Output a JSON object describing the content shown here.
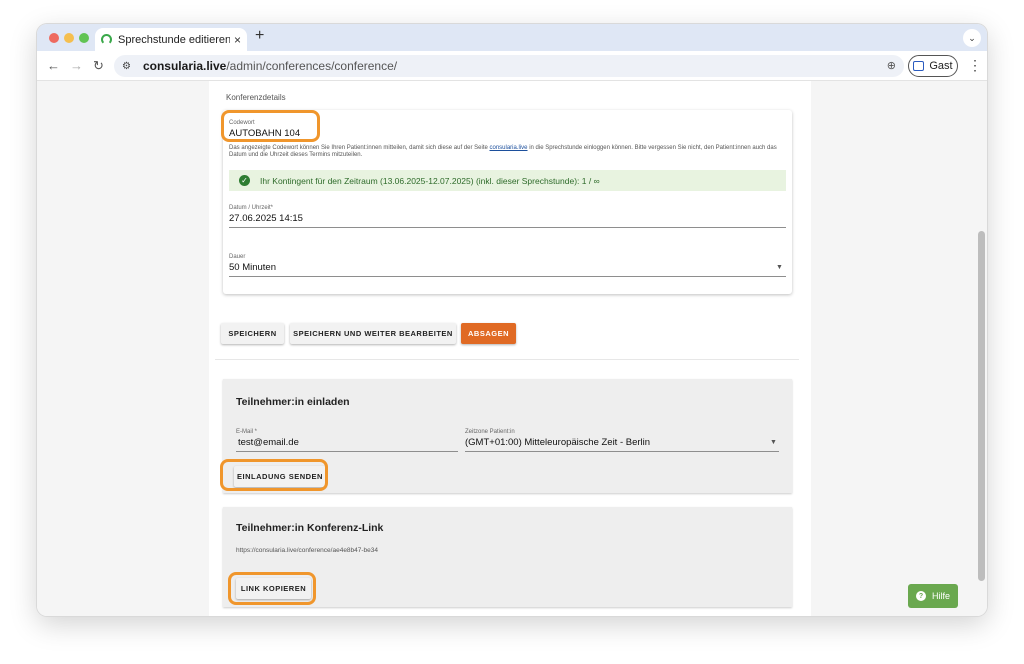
{
  "browser": {
    "tab_title": "Sprechstunde editieren",
    "tab_close": "×",
    "new_tab": "+",
    "tab_menu": "⌄",
    "url_host": "consularia.live",
    "url_path": "/admin/conferences/conference/",
    "profile_label": "Gast",
    "colors": {
      "close_dot": "#ee6a5f",
      "min_dot": "#f5bf4f",
      "max_dot": "#61c454"
    }
  },
  "form": {
    "section_title": "Konferenzdetails",
    "code_label": "Codewort",
    "code_value": "AUTOBAHN 104",
    "hint_before": "Das angezeigte Codewort können Sie Ihren Patient:innen mitteilen, damit sich diese auf der Seite ",
    "hint_link": "consularia.live",
    "hint_after": " in die Sprechstunde einloggen können. Bitte vergessen Sie nicht, den Patient:innen auch das Datum und die Uhrzeit dieses Termins mitzuteilen.",
    "quota_text": "Ihr Kontingent für den Zeitraum (13.06.2025-12.07.2025) (inkl. dieser Sprechstunde): 1 / ∞",
    "date_label": "Datum / Uhrzeit*",
    "date_value": "27.06.2025 14:15",
    "duration_label": "Dauer",
    "duration_value": "50 Minuten"
  },
  "actions": {
    "save": "SPEICHERN",
    "save_continue": "SPEICHERN UND WEITER BEARBEITEN",
    "cancel": "ABSAGEN"
  },
  "invite": {
    "heading": "Teilnehmer:in einladen",
    "email_label": "E-Mail *",
    "email_value": "test@email.de",
    "timezone_label": "Zeitzone Patient:in",
    "timezone_value": "(GMT+01:00) Mitteleuropäische Zeit - Berlin",
    "send_button": "EINLADUNG SENDEN"
  },
  "link": {
    "heading": "Teilnehmer:in Konferenz-Link",
    "url": "https://consularia.live/conference/ae4e8b47-be34",
    "copy_button": "LINK KOPIEREN"
  },
  "help": {
    "label": "Hilfe"
  },
  "colors": {
    "accent_orange": "#e06a24",
    "highlight": "#f0962c",
    "success_green": "#2e7d32",
    "help_green": "#6aa84f"
  }
}
